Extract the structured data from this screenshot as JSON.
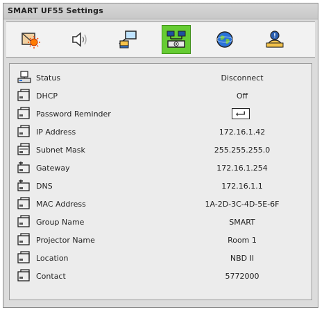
{
  "window": {
    "title": "SMART UF55 Settings"
  },
  "tabs": [
    {
      "icon": "picture-settings-icon",
      "active": false
    },
    {
      "icon": "speaker-icon",
      "active": false
    },
    {
      "icon": "projector-settings-icon",
      "active": false
    },
    {
      "icon": "network-icon",
      "active": true
    },
    {
      "icon": "globe-icon",
      "active": false
    },
    {
      "icon": "user-alert-icon",
      "active": false
    }
  ],
  "settings": [
    {
      "label": "Status",
      "value": "Disconnect",
      "icon": "network-status-icon"
    },
    {
      "label": "DHCP",
      "value": "Off",
      "icon": "network-card-icon"
    },
    {
      "label": "Password Reminder",
      "value": "",
      "icon": "network-card-icon",
      "control": "enter-key-icon"
    },
    {
      "label": "IP Address",
      "value": "172.16.1.42",
      "icon": "network-card-icon"
    },
    {
      "label": "Subnet Mask",
      "value": "255.255.255.0",
      "icon": "subnet-icon"
    },
    {
      "label": "Gateway",
      "value": "172.16.1.254",
      "icon": "gateway-icon"
    },
    {
      "label": "DNS",
      "value": "172.16.1.1",
      "icon": "dns-icon"
    },
    {
      "label": "MAC Address",
      "value": "1A-2D-3C-4D-5E-6F",
      "icon": "network-card-icon"
    },
    {
      "label": "Group Name",
      "value": "SMART",
      "icon": "network-card-icon"
    },
    {
      "label": "Projector Name",
      "value": "Room 1",
      "icon": "network-card-icon"
    },
    {
      "label": "Location",
      "value": "NBD II",
      "icon": "network-card-icon"
    },
    {
      "label": "Contact",
      "value": "5772000",
      "icon": "network-card-icon"
    }
  ],
  "colors": {
    "active_tab": "#66cc33",
    "panel": "#ececec",
    "frame": "#dcdcdc"
  }
}
